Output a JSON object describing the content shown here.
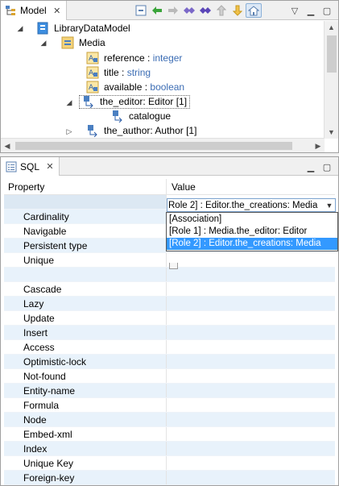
{
  "model_view": {
    "tab_label": "Model",
    "tree": {
      "root": "LibraryDataModel",
      "entity": "Media",
      "attributes": [
        {
          "name": "reference",
          "type": "integer"
        },
        {
          "name": "title",
          "type": "string"
        },
        {
          "name": "available",
          "type": "boolean"
        }
      ],
      "relation_selected": "the_editor: Editor [1]",
      "relation_child": "catalogue",
      "relation_next": "the_author: Author [1]",
      "type_separator": " : "
    },
    "toolbar_icons": [
      "collapse-all-icon",
      "back-icon",
      "forward-icon",
      "link-icon",
      "link-alt-icon",
      "up-icon",
      "down-icon",
      "home-icon"
    ]
  },
  "sql_view": {
    "tab_label": "SQL",
    "columns": {
      "property": "Property",
      "value": "Value"
    },
    "combo_value": "Role 2] : Editor.the_creations: Media",
    "dropdown_options": [
      "[Association]",
      "[Role 1] : Media.the_editor: Editor",
      "[Role 2] : Editor.the_creations: Media"
    ],
    "rows": [
      "",
      "Cardinality",
      "Navigable",
      "Persistent type",
      "Unique",
      "",
      "Cascade",
      "Lazy",
      "Update",
      "Insert",
      "Access",
      "Optimistic-lock",
      "Not-found",
      "Entity-name",
      "Formula",
      "Node",
      "Embed-xml",
      "Index",
      "Unique Key",
      "Foreign-key"
    ]
  },
  "colors": {
    "accent": "#3399ff",
    "type_text": "#3c6db4",
    "row_alt": "#e8f2fb"
  }
}
